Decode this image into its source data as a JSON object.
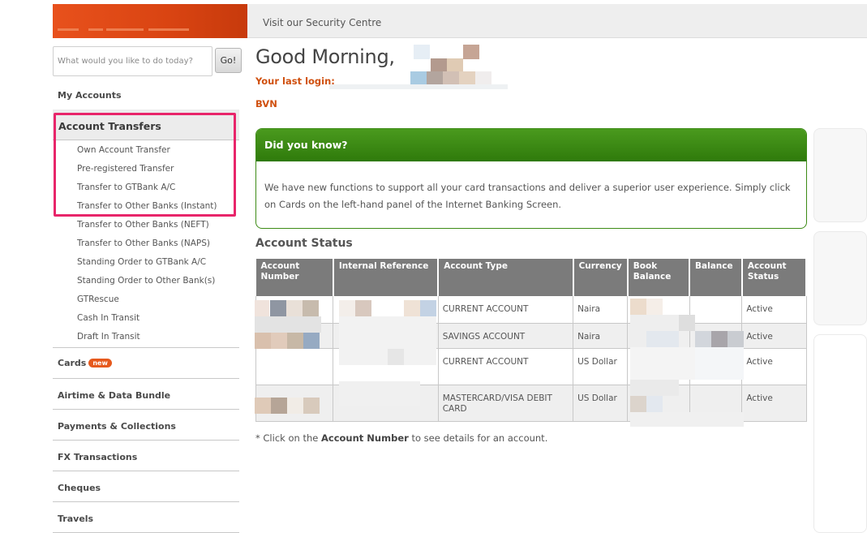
{
  "header": {
    "security_link": "Visit our Security Centre"
  },
  "search": {
    "placeholder": "What would you like to do today?",
    "button": "Go!"
  },
  "sidebar": {
    "my_accounts": "My Accounts",
    "account_transfers": "Account Transfers",
    "transfer_items": [
      "Own Account Transfer",
      "Pre-registered Transfer",
      "Transfer to GTBank A/C",
      "Transfer to Other Banks (Instant)",
      "Transfer to Other Banks (NEFT)",
      "Transfer to Other Banks (NAPS)",
      "Standing Order to GTBank A/C",
      "Standing Order to Other Bank(s)",
      "GTRescue",
      "Cash In Transit",
      "Draft In Transit"
    ],
    "cards": "Cards",
    "cards_badge": "new",
    "airtime": "Airtime & Data Bundle",
    "payments": "Payments & Collections",
    "fx": "FX Transactions",
    "cheques": "Cheques",
    "travels": "Travels"
  },
  "main": {
    "greeting": "Good Morning,",
    "last_login_label": "Your last login:",
    "bvn_label": "BVN",
    "did_you_know_title": "Did you know?",
    "did_you_know_body": "We have new functions to support all your card transactions and deliver a superior user experience. Simply click on Cards on the left-hand panel of the Internet Banking Screen.",
    "account_status_title": "Account Status",
    "table_headers": [
      "Account Number",
      "Internal Reference",
      "Account Type",
      "Currency",
      "Book Balance",
      "Balance",
      "Account Status"
    ],
    "rows": [
      {
        "type": "CURRENT ACCOUNT",
        "currency": "Naira",
        "status": "Active"
      },
      {
        "type": "SAVINGS ACCOUNT",
        "currency": "Naira",
        "status": "Active"
      },
      {
        "type": "CURRENT ACCOUNT",
        "currency": "US Dollar",
        "status": "Active"
      },
      {
        "type": "MASTERCARD/VISA DEBIT CARD",
        "currency": "US Dollar",
        "status": "Active"
      }
    ],
    "note_prefix": "* Click on the ",
    "note_bold": "Account Number",
    "note_suffix": " to see details for an account."
  },
  "colors": {
    "brand_orange": "#e8511c",
    "green_header": "#3d8b16",
    "highlight_pink": "#e8256a"
  }
}
